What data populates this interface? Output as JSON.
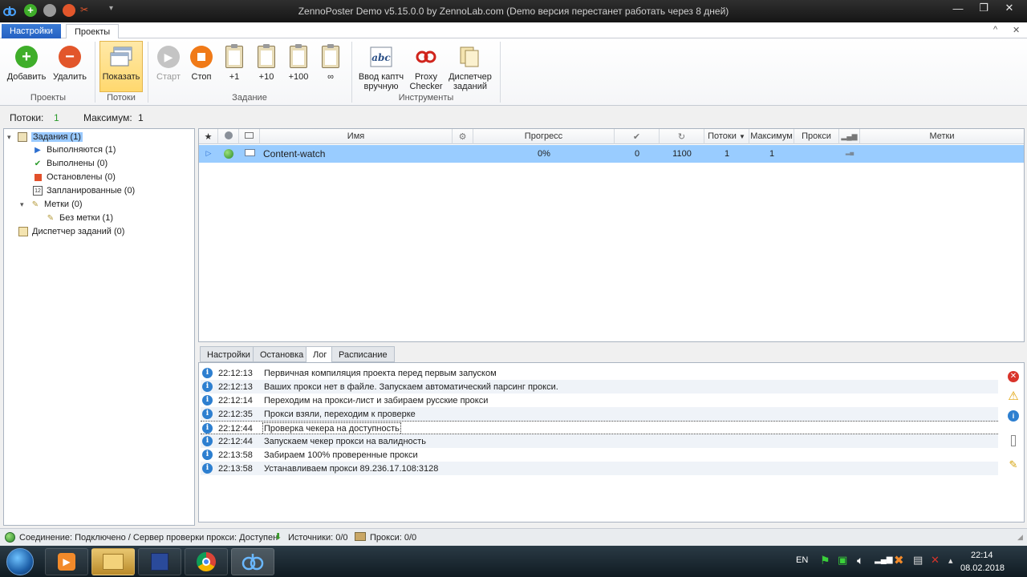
{
  "window": {
    "title": "ZennoPoster Demo v5.15.0.0 by ZennoLab.com (Demo версия перестанет работать через 8 дней)"
  },
  "ribbon_tabs": {
    "settings": "Настройки",
    "projects": "Проекты"
  },
  "ribbon": {
    "groups": {
      "projects": "Проекты",
      "threads": "Потоки",
      "task": "Задание",
      "tools": "Инструменты"
    },
    "buttons": {
      "add": "Добавить",
      "remove": "Удалить",
      "show": "Показать",
      "start": "Старт",
      "stop": "Стоп",
      "plus1": "+1",
      "plus10": "+10",
      "plus100": "+100",
      "infinite": "∞",
      "captcha_l1": "Ввод каптч",
      "captcha_l2": "вручную",
      "proxy_l1": "Proxy",
      "proxy_l2": "Checker",
      "dispatcher_l1": "Диспетчер",
      "dispatcher_l2": "заданий"
    }
  },
  "threads_bar": {
    "threads_label": "Потоки:",
    "threads_value": "1",
    "max_label": "Максимум:",
    "max_value": "1"
  },
  "tree": {
    "tasks": "Задания (1)",
    "running": "Выполняются (1)",
    "done": "Выполнены (0)",
    "stopped": "Остановлены (0)",
    "scheduled": "Запланированные (0)",
    "tags": "Метки (0)",
    "no_tag": "Без метки (1)",
    "dispatcher": "Диспетчер заданий (0)",
    "calendar_day": "12"
  },
  "grid": {
    "headers": {
      "name": "Имя",
      "progress": "Прогресс",
      "threads": "Потоки",
      "max": "Максимум",
      "proxy": "Прокси",
      "tags": "Метки"
    },
    "row": {
      "name": "Content-watch",
      "progress": "0%",
      "done": "0",
      "repeat": "1100",
      "threads": "1",
      "max": "1"
    }
  },
  "bottom_tabs": {
    "settings": "Настройки",
    "stop": "Остановка",
    "log": "Лог",
    "schedule": "Расписание"
  },
  "log": [
    {
      "time": "22:12:13",
      "message": "Первичная компиляция проекта перед первым запуском"
    },
    {
      "time": "22:12:13",
      "message": "Ваших прокси нет в файле. Запускаем автоматический парсинг прокси."
    },
    {
      "time": "22:12:14",
      "message": "Переходим на прокси-лист и забираем русские прокси"
    },
    {
      "time": "22:12:35",
      "message": "Прокси взяли, переходим к проверке"
    },
    {
      "time": "22:12:44",
      "message": "Проверка чекера на доступность"
    },
    {
      "time": "22:12:44",
      "message": "Запускаем чекер прокси на валидность"
    },
    {
      "time": "22:13:58",
      "message": "Забираем 100% проверенные прокси"
    },
    {
      "time": "22:13:58",
      "message": "Устанавливаем прокси 89.236.17.108:3128"
    }
  ],
  "status_bar": {
    "connection": "Соединение: Подключено / Сервер проверки прокси: Доступен",
    "sources": "Источники: 0/0",
    "proxies": "Прокси: 0/0"
  },
  "taskbar": {
    "lang": "EN",
    "time": "22:14",
    "date": "08.02.2018"
  },
  "colors": {
    "accent": "#2561c3",
    "selection": "#99ccff",
    "tree_selection": "#99c9ff",
    "add_green": "#3fae2a",
    "remove_red": "#e2562b",
    "stop_orange": "#f07a18"
  }
}
